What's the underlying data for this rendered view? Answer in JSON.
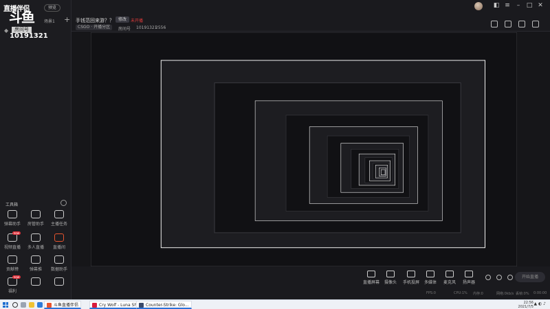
{
  "brand": {
    "line1": "直播伴侣",
    "line2": "斗鱼",
    "line3": "房间号"
  },
  "preview_pill": "预览",
  "room_number": "10191321",
  "scenes": {
    "label": "场景1"
  },
  "topbar": {
    "title": "手钱范回来游？？",
    "modify_label": "修改",
    "live_status": "未开播",
    "category": "CSGO · 开播分区",
    "room_label": "房间号",
    "room_value": "10191321",
    "fans_value": "2556"
  },
  "tools": {
    "title": "工具箱",
    "items": [
      {
        "label": "弹幕助手",
        "badge": ""
      },
      {
        "label": "房管助手",
        "badge": ""
      },
      {
        "label": "主播任务",
        "badge": ""
      },
      {
        "label": "视频直播",
        "badge": "new"
      },
      {
        "label": "多人直播",
        "badge": ""
      },
      {
        "label": "直播间",
        "badge": ""
      },
      {
        "label": "贡献榜",
        "badge": ""
      },
      {
        "label": "弹幕推",
        "badge": ""
      },
      {
        "label": "数据助手",
        "badge": ""
      },
      {
        "label": "福利",
        "badge": "new"
      },
      {
        "label": "",
        "badge": ""
      },
      {
        "label": "",
        "badge": ""
      }
    ]
  },
  "toolbar": {
    "buttons": [
      {
        "label": "直播屏幕"
      },
      {
        "label": "摄像头"
      },
      {
        "label": "手机投屏"
      },
      {
        "label": "多媒体"
      },
      {
        "label": "麦克风"
      },
      {
        "label": "扬声器"
      }
    ],
    "go_live": "开始直播",
    "stats": [
      "FPS:0",
      "CPU:1%",
      "内存:0",
      "网络:0kb/s",
      "丢帧:0%",
      "0:00:00"
    ]
  },
  "taskbar": {
    "apps": [
      {
        "label": "斗鱼直播伴侣",
        "color": "#e8552e"
      },
      {
        "label": "Cry Wolf - Luna Sh...",
        "color": "#d81b3c"
      },
      {
        "label": "Counter-Strike: Glo...",
        "color": "#3a4a6a"
      }
    ],
    "time": "22:56",
    "date": "2021/7/5"
  }
}
